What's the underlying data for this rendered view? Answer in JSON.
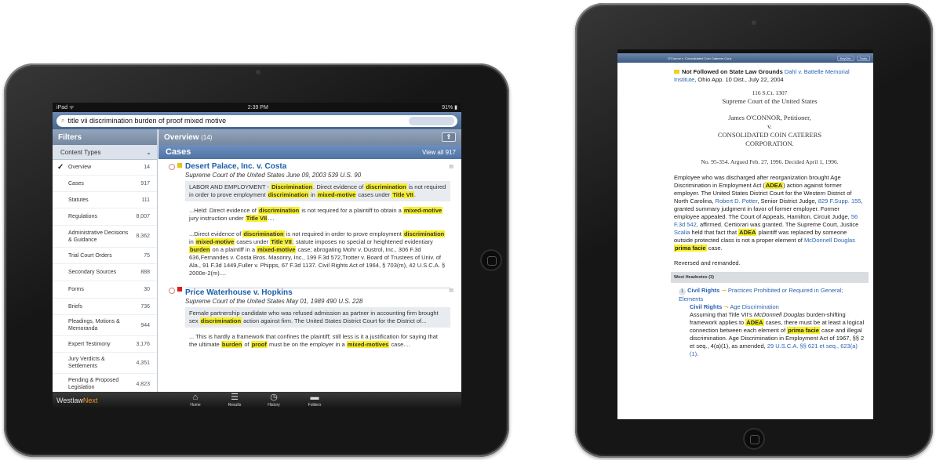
{
  "left": {
    "status": {
      "carrier": "iPad ᯤ",
      "time": "2:39 PM",
      "battery": "91% ▮"
    },
    "search": {
      "query": "title vii discrimination burden of proof mixed motive"
    },
    "filters": {
      "title": "Filters",
      "content_types_label": "Content Types",
      "items": [
        {
          "label": "Overview",
          "count": "14",
          "checked": true
        },
        {
          "label": "Cases",
          "count": "917"
        },
        {
          "label": "Statutes",
          "count": "111"
        },
        {
          "label": "Regulations",
          "count": "8,007"
        },
        {
          "label": "Administrative Decisions & Guidance",
          "count": "8,362"
        },
        {
          "label": "Trial Court Orders",
          "count": "75"
        },
        {
          "label": "Secondary Sources",
          "count": "888"
        },
        {
          "label": "Forms",
          "count": "30"
        },
        {
          "label": "Briefs",
          "count": "736"
        },
        {
          "label": "Pleadings, Motions & Memoranda",
          "count": "944"
        },
        {
          "label": "Expert Testimony",
          "count": "3,176"
        },
        {
          "label": "Jury Verdicts & Settlements",
          "count": "4,351"
        },
        {
          "label": "Pending & Proposed Legislation",
          "count": "4,823"
        }
      ]
    },
    "overview": {
      "title": "Overview",
      "count": "(14)",
      "share_icon": "share-icon"
    },
    "cases": {
      "title": "Cases",
      "view_all": "View all 917",
      "results": [
        {
          "title": "Desert Palace, Inc. v. Costa",
          "citation": "Supreme Court of the United States June 09, 2003 539 U.S. 90",
          "flag_color": "#e6c21a",
          "snippets": [
            {
              "shaded": true,
              "parts": [
                "LABOR AND EMPLOYMENT - ",
                {
                  "hl": "Discrimination"
                },
                ". Direct evidence of ",
                {
                  "hl": "discrimination"
                },
                " is not required in order to prove employment ",
                {
                  "hl": "discrimination"
                },
                " in ",
                {
                  "hl": "mixed-motive"
                },
                " cases under ",
                {
                  "hl": "Title VII"
                },
                "."
              ]
            },
            {
              "shaded": false,
              "parts": [
                "...Held: Direct evidence of ",
                {
                  "hl": "discrimination"
                },
                " is not required for a plaintiff to obtain a ",
                {
                  "hl": "mixed-motive"
                },
                " jury instruction under ",
                {
                  "hl": "Title VII"
                },
                "...."
              ]
            },
            {
              "shaded": false,
              "parts": [
                "...Direct evidence of ",
                {
                  "hl": "discrimination"
                },
                " is not required in order to prove employment ",
                {
                  "hl": "discrimination"
                },
                " in ",
                {
                  "hl": "mixed-motive"
                },
                " cases under ",
                {
                  "hl": "Title VII"
                },
                "; statute imposes no special or heightened evidentiary ",
                {
                  "hl": "burden"
                },
                " on a plaintiff in a ",
                {
                  "hl": "mixed-motive"
                },
                " case; abrogating Mohr v. Dustrol, Inc., 306 F.3d 636,Fernandes v. Costa Bros. Masonry, Inc., 199 F.3d 572,Trotter v. Board of Trustees of Univ. of Ala., 91 F.3d 1449,Fuller v. Phipps, 67 F.3d 1137.   Civil Rights Act of 1964, § 703(m), 42 U.S.C.A. § 2000e-2(m)...."
              ]
            }
          ]
        },
        {
          "title": "Price Waterhouse v. Hopkins",
          "citation": "Supreme Court of the United States May 01, 1989 490 U.S. 228",
          "flag_color": "#d62020",
          "snippets": [
            {
              "shaded": true,
              "parts": [
                "Female partnership candidate who was refused admission as partner in accounting firm brought sex ",
                {
                  "hl": "discrimination"
                },
                " action against firm. The United States District Court for the District of..."
              ]
            },
            {
              "shaded": false,
              "parts": [
                "...  This is hardly a framework that confines the plaintiff; still less is it a justification for saying that the ultimate ",
                {
                  "hl": "burden"
                },
                " of ",
                {
                  "hl": "proof"
                },
                " must be on the employer in a ",
                {
                  "hl": "mixed-motives"
                },
                " case...."
              ]
            }
          ]
        }
      ]
    },
    "tabbar": {
      "logo_a": "Westlaw",
      "logo_b": "Next",
      "tabs": [
        {
          "label": "Home",
          "icon": "home-icon",
          "glyph": "⌂"
        },
        {
          "label": "Results",
          "icon": "list-icon",
          "glyph": "☰"
        },
        {
          "label": "History",
          "icon": "clock-icon",
          "glyph": "◷"
        },
        {
          "label": "Folders",
          "icon": "folder-icon",
          "glyph": "▬"
        }
      ]
    }
  },
  "right": {
    "nav": {
      "doc_title": "O'Connor v. Consolidated Coin Caterers Corp.",
      "keycite_btn": "KeyCite",
      "tools_btn": "Tools"
    },
    "keycite": {
      "label": "Not Followed on State Law Grounds",
      "link": "Dahl v. Battelle Memorial Institute",
      "rest": ", Ohio App. 10 Dist., July 22, 2004"
    },
    "citation": "116 S.Ct. 1307",
    "court": "Supreme Court of the United States",
    "party1": "James O'CONNOR, Petitioner,",
    "v": "v.",
    "party2a": "CONSOLIDATED COIN CATERERS",
    "party2b": "CORPORATION.",
    "docket": "No. 95-354.  Argued Feb. 27, 1996.  Decided April 1, 1996.",
    "synopsis": [
      "Employee who was discharged after reorganization brought Age Discrimination in Employment Act (",
      {
        "hl": "ADEA"
      },
      ") action against former employer. The United States District Court for the Western District of North Carolina, ",
      {
        "link": "Robert D. Potter"
      },
      ", Senior District Judge, ",
      {
        "link": "829 F.Supp. 155"
      },
      ", granted summary judgment in favor of former employer. Former employee appealed. The Court of Appeals, Hamilton, Circuit Judge, ",
      {
        "link": "56 F.3d 542"
      },
      ", affirmed. Certiorari was granted. The Supreme Court, Justice ",
      {
        "link": "Scalia"
      },
      " held that fact that ",
      {
        "hl": "ADEA"
      },
      " plaintiff was replaced by someone outside protected class is not a proper element of ",
      {
        "link": "McDonnell Douglas"
      },
      " ",
      {
        "hl": "prima facie"
      },
      " case."
    ],
    "disposition": "Reversed and remanded.",
    "headnotes_label": "West Headnotes (3)",
    "headnote": {
      "num": "1",
      "topic": "Civil Rights",
      "sub1": "Practices Prohibited or Required in General; Elements",
      "topic2": "Civil Rights",
      "sub2": "Age Discrimination",
      "text": [
        "Assuming that Title VII's ",
        {
          "em": "McDonnell Douglas"
        },
        " burden-shifting framework applies to ",
        {
          "hl": "ADEA"
        },
        " cases, there must be at least a logical connection between each element of ",
        {
          "hl": "prima facie"
        },
        " case and illegal discrimination. Age Discrimination in Employment Act of 1967, §§ 2 et seq., 4(a)(1), as amended, ",
        {
          "link": "29 U.S.C.A. §§ 621 et seq., 623(a)(1)"
        },
        "."
      ]
    }
  }
}
